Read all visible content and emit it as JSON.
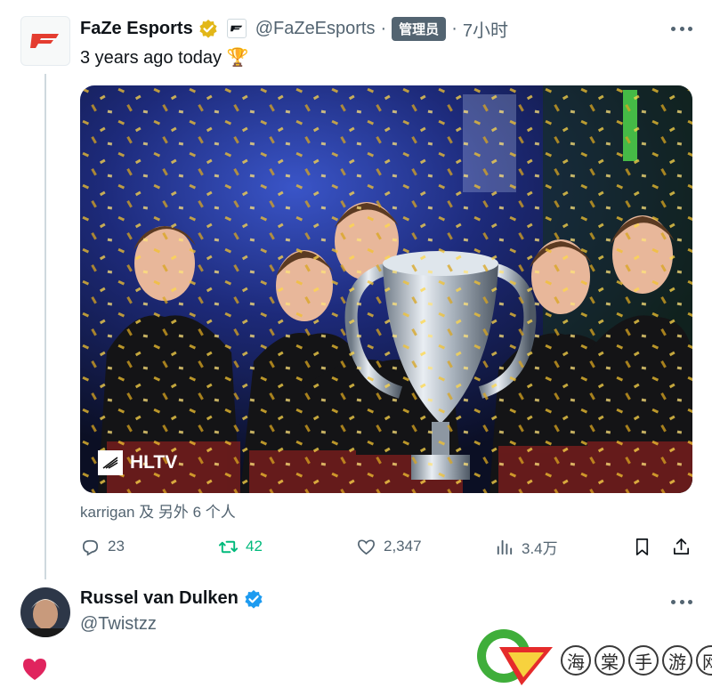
{
  "tweet": {
    "author_name": "FaZe Esports",
    "handle": "@FaZeEsports",
    "separator": "·",
    "badge": "管理员",
    "time": "7小时",
    "text": "3 years ago today 🏆",
    "media_watermark": "HLTV",
    "tagged": "karrigan 及 另外 6 个人",
    "stats": {
      "replies": "23",
      "retweets": "42",
      "likes": "2,347",
      "views": "3.4万"
    }
  },
  "reply": {
    "author_name": "Russel van Dulken",
    "handle": "@Twistzz",
    "text": "❤️"
  },
  "watermark": {
    "chars": [
      "海",
      "棠",
      "手",
      "游",
      "网"
    ]
  },
  "colors": {
    "accent_blue": "#1d9bf0",
    "retweet_green": "#00ba7c",
    "verified_gold": "#e2b719",
    "faze_red": "#e43d30",
    "muted": "#536471",
    "badge_bg": "#536471"
  },
  "icons": {
    "reply": "reply-icon",
    "retweet": "retweet-icon",
    "like": "heart-icon",
    "views": "views-icon",
    "bookmark": "bookmark-icon",
    "share": "share-icon",
    "more": "more-icon"
  }
}
